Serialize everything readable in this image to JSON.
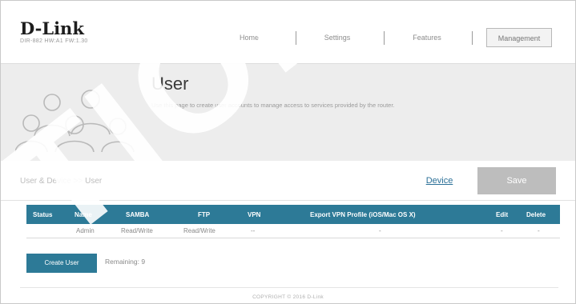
{
  "header": {
    "logo": "D-Link",
    "model": "DIR-882 HW:A1 FW:1.30",
    "nav": [
      {
        "label": "Home",
        "active": false
      },
      {
        "label": "Settings",
        "active": false
      },
      {
        "label": "Features",
        "active": false
      },
      {
        "label": "Management",
        "active": true
      }
    ]
  },
  "banner": {
    "title": "User",
    "description": "Use this page to create user accounts to manage access to services provided by the router.",
    "icon": "users-icon"
  },
  "subbar": {
    "breadcrumb": "User & Device >> User",
    "device_label": "Device",
    "save_label": "Save"
  },
  "table": {
    "columns": [
      "Status",
      "Name",
      "SAMBA",
      "FTP",
      "VPN",
      "Export VPN Profile (iOS/Mac OS X)",
      "Edit",
      "Delete"
    ],
    "rows": [
      {
        "status": "",
        "name": "Admin",
        "samba": "Read/Write",
        "ftp": "Read/Write",
        "vpn": "--",
        "export": "-",
        "edit": "-",
        "delete": "-"
      }
    ]
  },
  "footer": {
    "create_label": "Create User",
    "remaining_label": "Remaining: 9",
    "copyright": "COPYRIGHT © 2016 D-Link"
  },
  "watermark": "TION",
  "colors": {
    "accent": "#2d7a97",
    "banner_bg": "#ededed",
    "save_disabled": "#bdbdbd"
  }
}
